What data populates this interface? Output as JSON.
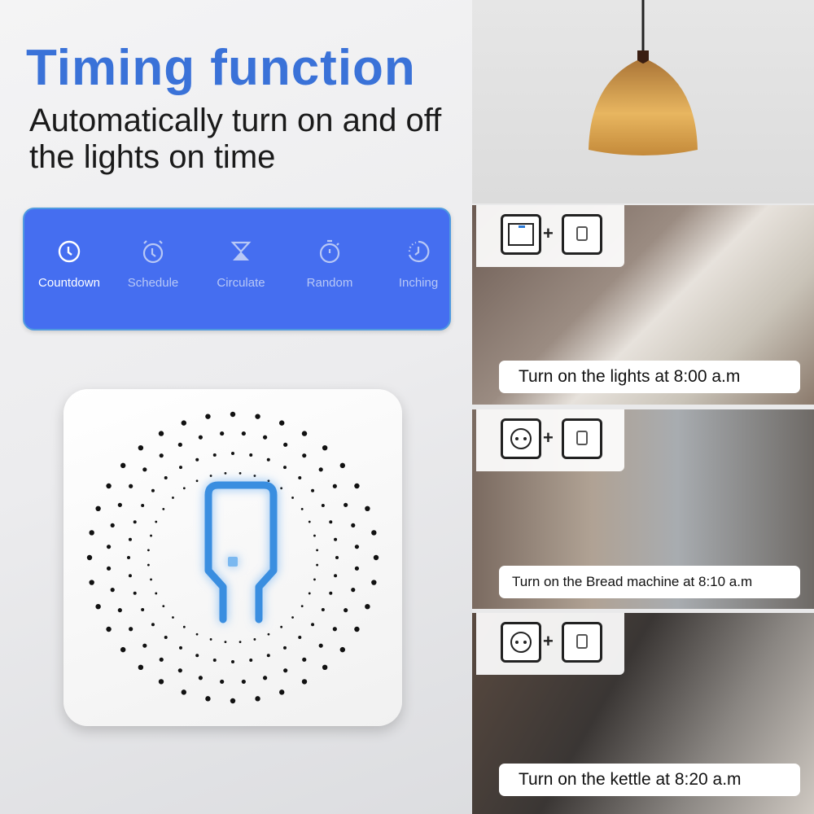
{
  "header": {
    "title": "Timing function",
    "subtitle": "Automatically turn on and off the lights on time"
  },
  "modes": [
    {
      "label": "Countdown",
      "icon": "clock-icon",
      "active": true
    },
    {
      "label": "Schedule",
      "icon": "alarm-clock-icon",
      "active": false
    },
    {
      "label": "Circulate",
      "icon": "hourglass-icon",
      "active": false
    },
    {
      "label": "Random",
      "icon": "stopwatch-icon",
      "active": false
    },
    {
      "label": "Inching",
      "icon": "dotted-clock-icon",
      "active": false
    }
  ],
  "scenes": [
    {
      "caption": "Turn on the lights at 8:00 a.m",
      "device": "wall-switch-icon",
      "plus": "+"
    },
    {
      "caption": "Turn on the Bread machine at 8:10 a.m",
      "device": "socket-icon",
      "plus": "+"
    },
    {
      "caption": "Turn on the kettle at 8:20 a.m",
      "device": "socket-icon",
      "plus": "+"
    }
  ],
  "colors": {
    "accent": "#3a72d8",
    "panel": "#456ef0",
    "led": "#3a8ee0"
  }
}
